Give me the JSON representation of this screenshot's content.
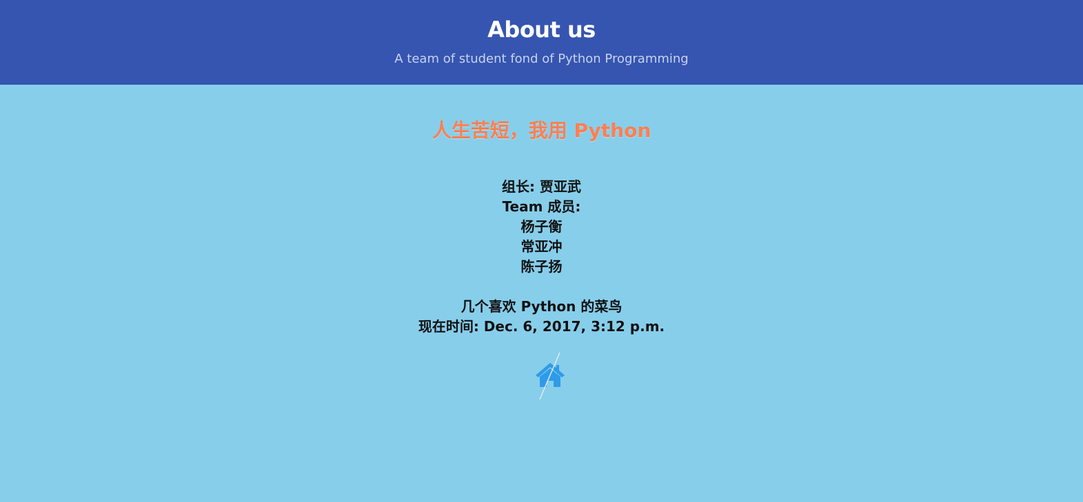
{
  "header": {
    "title": "About us",
    "subtitle": "A team of student fond of Python Programming"
  },
  "slogan": "人生苦短，我用 Python",
  "team": {
    "leader": "组长: 贾亚武",
    "members_label": "Team 成员:",
    "members": [
      "杨子衡",
      "常亚冲",
      "陈子扬"
    ],
    "description": "几个喜欢 Python 的菜鸟",
    "current_time": "现在时间: Dec. 6, 2017, 3:12 p.m."
  },
  "home_link": {
    "icon": "home-icon",
    "color": "#2f9be8"
  },
  "colors": {
    "header_bg": "#3555b0",
    "page_bg": "#87ceeb",
    "slogan": "#ff7f50"
  }
}
